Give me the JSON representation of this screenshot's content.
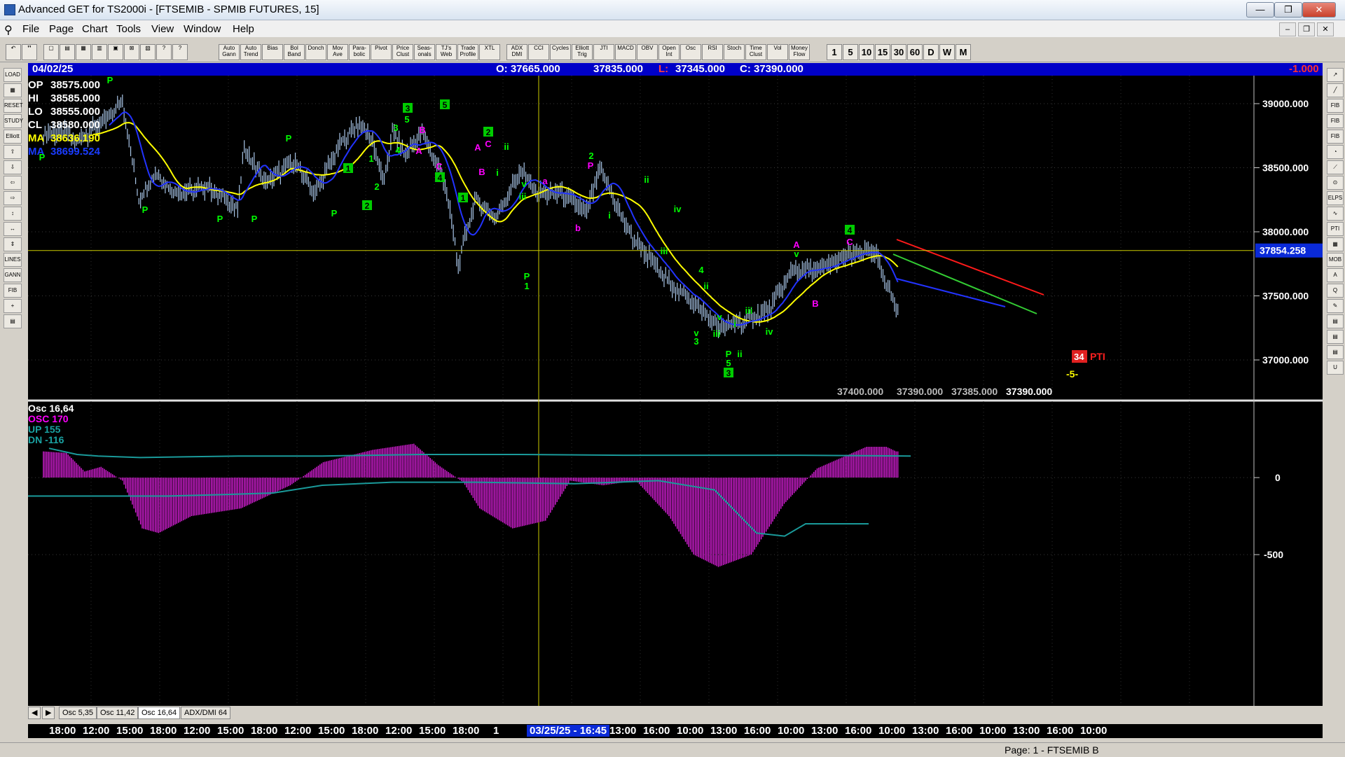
{
  "window": {
    "title": "Advanced GET for TS2000i - [FTSEMIB - SPMIB FUTURES, 15]",
    "minimize": "—",
    "maximize": "❐",
    "close": "✕",
    "mdi_minimize": "–",
    "mdi_restore": "❐",
    "mdi_close": "✕"
  },
  "menu": [
    "File",
    "Page",
    "Chart",
    "Tools",
    "View",
    "Window",
    "Help"
  ],
  "toolbar": {
    "left_buttons": [
      "↶",
      "❜❜",
      "▢",
      "▤",
      "▦",
      "▥",
      "▣",
      "⊠",
      "▧",
      "?",
      "?"
    ],
    "study_buttons": [
      "Auto Gann",
      "Auto Trend",
      "Bias",
      "Bol Band",
      "Donch",
      "Mov Ave",
      "Para- bolic",
      "Pivot",
      "Price Clust",
      "Seas- onals",
      "TJ's Web",
      "Trade Profile",
      "XTL",
      "ADX DMI",
      "CCI",
      "Cycles",
      "Elliott Trig",
      "JTI",
      "MACD",
      "OBV",
      "Open Int",
      "Osc",
      "RSI",
      "Stoch",
      "Time Clust",
      "Vol",
      "Money Flow"
    ],
    "intervals": [
      "1",
      "5",
      "10",
      "15",
      "30",
      "60",
      "D",
      "W",
      "M"
    ]
  },
  "leftbar": [
    "LOAD",
    "▦",
    "RESET",
    "STUDY",
    "Elliott",
    "⇧",
    "⇩",
    "⇦",
    "⇨",
    "↕",
    "↔",
    "⇕",
    "LINES",
    "GANN",
    "FIB",
    "+",
    "▤"
  ],
  "rightbar": [
    "↗",
    "╱",
    "FIB RET",
    "FIB EXT",
    "FIB TIME",
    "◔",
    "⟋",
    "⊙",
    "ELPS",
    "∿",
    "PTI",
    "▦",
    "MOB",
    "A",
    "Q",
    "✎",
    "▤",
    "▤",
    "▤",
    "U"
  ],
  "infobar": {
    "date": "04/02/25",
    "open": "O: 37665.000",
    "high": "37835.000",
    "low_label": "L:",
    "low": "37345.000",
    "close": "C: 37390.000",
    "change": "-1.000"
  },
  "price_panel": {
    "legend": [
      {
        "label": "OP",
        "value": "38575.000",
        "color": "#ffffff"
      },
      {
        "label": "HI",
        "value": "38585.000",
        "color": "#ffffff"
      },
      {
        "label": "LO",
        "value": "38555.000",
        "color": "#ffffff"
      },
      {
        "label": "CL",
        "value": "38580.000",
        "color": "#ffffff"
      },
      {
        "label": "MA",
        "value": "38636.190",
        "color": "#ffff00"
      },
      {
        "label": "MA",
        "value": "38699.524",
        "color": "#1a3cff"
      }
    ],
    "y_ticks": [
      "39000.000",
      "38500.000",
      "38000.000",
      "37500.000",
      "37000.000"
    ],
    "current_price": "37854.258",
    "pti_value": "34",
    "pti_label": "PTI",
    "projection_label": "-5-",
    "bottom_values": [
      "37400.000",
      "37390.000",
      "37385.000",
      "37390.000"
    ],
    "colors": {
      "price_bar": "#a9c6e8",
      "ma_fast": "#ffff00",
      "ma_slow": "#2233ff",
      "wave_label": "#00ff00",
      "abc_label": "#ff00ff",
      "channel_red": "#ff1a1a",
      "channel_green": "#33cc33",
      "channel_blue": "#2233ff"
    }
  },
  "osc_panel": {
    "legend": [
      {
        "label": "Osc 16,64",
        "color": "#ffffff"
      },
      {
        "label": "OSC 170",
        "color": "#ff00ff"
      },
      {
        "label": "UP  155",
        "color": "#1aa3a3"
      },
      {
        "label": "DN  -116",
        "color": "#1aa3a3"
      }
    ],
    "y_ticks": [
      "0",
      "-500"
    ],
    "colors": {
      "histogram": "#e020e0",
      "bands": "#1a9a9a"
    }
  },
  "tabs": [
    "Osc 5,35",
    "Osc 11,42",
    "Osc 16,64",
    "ADX/DMI 64"
  ],
  "tab_arrows": [
    "◀",
    "▶"
  ],
  "time_axis": {
    "labels": [
      "18:00",
      "12:00",
      "15:00",
      "18:00",
      "12:00",
      "15:00",
      "18:00",
      "12:00",
      "15:00",
      "18:00",
      "12:00",
      "15:00",
      "18:00",
      "1",
      "03/25/25 - 16:45",
      "13:00",
      "16:00",
      "10:00",
      "13:00",
      "16:00",
      "10:00",
      "13:00",
      "16:00",
      "10:00",
      "13:00",
      "16:00",
      "10:00",
      "13:00",
      "16:00",
      "10:00"
    ],
    "highlight": "03/25/25 - 16:45"
  },
  "status": "Page: 1 - FTSEMIB B"
}
